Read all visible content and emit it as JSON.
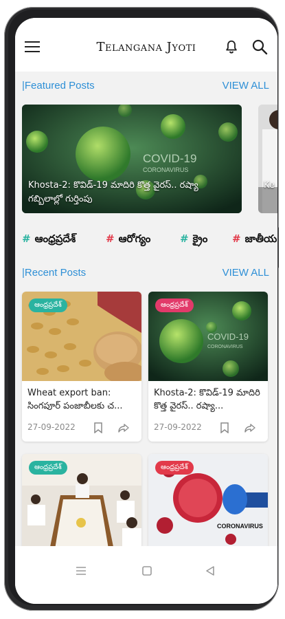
{
  "app": {
    "title": "Telangana Jyoti"
  },
  "featured": {
    "section_title": "|Featured Posts",
    "view_all": "VIEW ALL",
    "items": [
      {
        "title": "Khosta-2: కొవిడ్-19 మాదిరి కొత్త వైరస్.. రష్యా గబ్బిలాల్లో గుర్తింపు",
        "image_text": "COVID-19\nCORONAVIRUS"
      },
      {
        "title": "Ke"
      }
    ]
  },
  "tags": [
    {
      "label": "ఆంధ్రప్రదేశ్",
      "hash": "#",
      "color": "#2ab3a0"
    },
    {
      "label": "ఆరోగ్యం",
      "hash": "#",
      "color": "#e23a4a"
    },
    {
      "label": "క్రైం",
      "hash": "#",
      "color": "#2ab3a0"
    },
    {
      "label": "జాతీయ",
      "hash": "#",
      "color": "#e23a4a"
    }
  ],
  "recent": {
    "section_title": "|Recent Posts",
    "view_all": "VIEW ALL",
    "posts": [
      {
        "badge": "ఆంధ్రప్రదేశ్",
        "badge_color": "#2ab3a0",
        "title": "Wheat export ban: సింగపూర్ పంజాబీలకు చ...",
        "date": "27-09-2022"
      },
      {
        "badge": "ఆంధ్రప్రదేశ్",
        "badge_color": "#e23a6a",
        "title": "Khosta-2: కొవిడ్-19 మాదిరి కొత్త వైరస్.. రష్యా...",
        "date": "27-09-2022",
        "image_text": "COVID-19\nCORONAVIRUS"
      },
      {
        "badge": "ఆంధ్రప్రదేశ్",
        "badge_color": "#2ab3a0"
      },
      {
        "badge": "ఆంధ్రప్రదేశ్",
        "badge_color": "#e23a4a",
        "image_text": "CORONAVIRUS"
      }
    ]
  },
  "icons": [
    "menu-icon",
    "bell-icon",
    "search-icon",
    "bookmark-icon",
    "share-icon",
    "nav-menu-icon",
    "nav-home-icon",
    "nav-back-icon"
  ]
}
